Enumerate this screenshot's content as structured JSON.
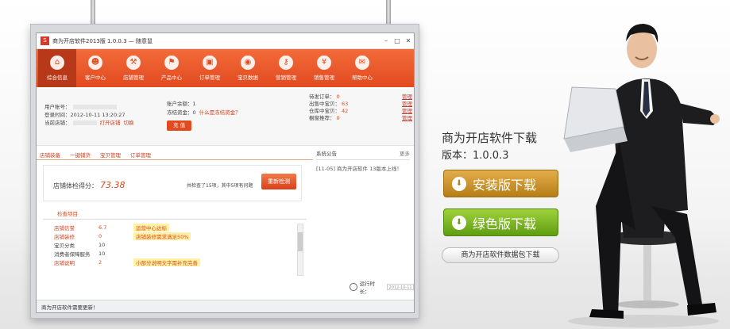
{
  "app": {
    "title": "商为开店软件2013版 1.0.0.3 — 随意鼠",
    "logo_letter": "S",
    "controls": [
      "–",
      "□",
      "✕"
    ]
  },
  "nav": [
    {
      "label": "综合信息",
      "icon": "home-icon",
      "glyph": "⌂",
      "active": true
    },
    {
      "label": "客户中心",
      "icon": "users-icon",
      "glyph": "☻"
    },
    {
      "label": "店铺管理",
      "icon": "hammer-icon",
      "glyph": "⚒"
    },
    {
      "label": "产品中心",
      "icon": "cart-icon",
      "glyph": "⚑"
    },
    {
      "label": "订单管理",
      "icon": "order-icon",
      "glyph": "▣"
    },
    {
      "label": "宝贝数据",
      "icon": "eye-icon",
      "glyph": "◉"
    },
    {
      "label": "营销管理",
      "icon": "key-icon",
      "glyph": "⚷"
    },
    {
      "label": "销售管理",
      "icon": "yen-icon",
      "glyph": "¥"
    },
    {
      "label": "帮助中心",
      "icon": "chat-icon",
      "glyph": "✉"
    }
  ],
  "account": {
    "user_label": "用户账号：",
    "login_label": "登录时间：",
    "login_time": "2012-10-11 13:20:27",
    "shop_label": "当前店铺：",
    "open_store": "打开店铺",
    "switch": "切换",
    "balance_label": "账户余额：",
    "balance_value": "1",
    "pay_label": "冻结资金：",
    "pay_value": "0",
    "what_is": "什么是冻结资金？",
    "charge_button": "充 值"
  },
  "stats": [
    {
      "label": "待发订单：",
      "value": "0",
      "action": "管理"
    },
    {
      "label": "出售中宝贝：",
      "value": "63",
      "action": "管理"
    },
    {
      "label": "仓库中宝贝：",
      "value": "42",
      "action": "管理"
    },
    {
      "label": "橱窗推荐：",
      "value": "0",
      "action": "管理"
    }
  ],
  "tabs": [
    "店铺装备",
    "一键铺货",
    "宝贝管理",
    "订单管理"
  ],
  "score": {
    "label": "店铺体检得分：",
    "value": "73.38",
    "summary": "共检查了15项，其中5项有问题",
    "redo_button": "重新检测"
  },
  "checks": {
    "heading": "检查项目",
    "rows": [
      {
        "name": "店铺信誉",
        "count": "6.7",
        "tip": "运营中心达标",
        "flag": true
      },
      {
        "name": "店铺装修",
        "count": "0",
        "tip": "店铺装修需求满足50%",
        "flag": true
      },
      {
        "name": "宝贝分类",
        "count": "10",
        "tip": "",
        "flag": false
      },
      {
        "name": "消费者保障服务",
        "count": "10",
        "tip": "",
        "flag": false
      },
      {
        "name": "店铺说明",
        "count": "2",
        "tip": "小部分说明文字需补充完善",
        "flag": true
      }
    ]
  },
  "notice": {
    "heading": "系统公告",
    "more": "更多",
    "items": [
      "[11-05] 商为开店软件 13版本上线！"
    ]
  },
  "clock": {
    "label": "运行时长：",
    "value": "2012-10-11"
  },
  "statusbar": "商为开店软件需要更新！",
  "promo": {
    "title": "商为开店软件下载",
    "version": "版本：1.0.0.3",
    "install_button": "安装版下载",
    "portable_button": "绿色版下载",
    "data_button": "商为开店软件数据包下载",
    "colors": {
      "install": "#c68d23",
      "portable": "#7cb625"
    }
  }
}
